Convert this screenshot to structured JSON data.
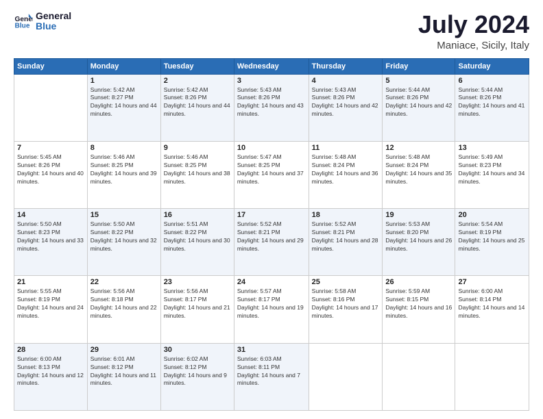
{
  "header": {
    "logo_line1": "General",
    "logo_line2": "Blue",
    "title": "July 2024",
    "subtitle": "Maniace, Sicily, Italy"
  },
  "days_of_week": [
    "Sunday",
    "Monday",
    "Tuesday",
    "Wednesday",
    "Thursday",
    "Friday",
    "Saturday"
  ],
  "weeks": [
    [
      {
        "day": null,
        "info": null
      },
      {
        "day": "1",
        "sunrise": "5:42 AM",
        "sunset": "8:27 PM",
        "daylight": "14 hours and 44 minutes."
      },
      {
        "day": "2",
        "sunrise": "5:42 AM",
        "sunset": "8:26 PM",
        "daylight": "14 hours and 44 minutes."
      },
      {
        "day": "3",
        "sunrise": "5:43 AM",
        "sunset": "8:26 PM",
        "daylight": "14 hours and 43 minutes."
      },
      {
        "day": "4",
        "sunrise": "5:43 AM",
        "sunset": "8:26 PM",
        "daylight": "14 hours and 42 minutes."
      },
      {
        "day": "5",
        "sunrise": "5:44 AM",
        "sunset": "8:26 PM",
        "daylight": "14 hours and 42 minutes."
      },
      {
        "day": "6",
        "sunrise": "5:44 AM",
        "sunset": "8:26 PM",
        "daylight": "14 hours and 41 minutes."
      }
    ],
    [
      {
        "day": "7",
        "sunrise": "5:45 AM",
        "sunset": "8:26 PM",
        "daylight": "14 hours and 40 minutes."
      },
      {
        "day": "8",
        "sunrise": "5:46 AM",
        "sunset": "8:25 PM",
        "daylight": "14 hours and 39 minutes."
      },
      {
        "day": "9",
        "sunrise": "5:46 AM",
        "sunset": "8:25 PM",
        "daylight": "14 hours and 38 minutes."
      },
      {
        "day": "10",
        "sunrise": "5:47 AM",
        "sunset": "8:25 PM",
        "daylight": "14 hours and 37 minutes."
      },
      {
        "day": "11",
        "sunrise": "5:48 AM",
        "sunset": "8:24 PM",
        "daylight": "14 hours and 36 minutes."
      },
      {
        "day": "12",
        "sunrise": "5:48 AM",
        "sunset": "8:24 PM",
        "daylight": "14 hours and 35 minutes."
      },
      {
        "day": "13",
        "sunrise": "5:49 AM",
        "sunset": "8:23 PM",
        "daylight": "14 hours and 34 minutes."
      }
    ],
    [
      {
        "day": "14",
        "sunrise": "5:50 AM",
        "sunset": "8:23 PM",
        "daylight": "14 hours and 33 minutes."
      },
      {
        "day": "15",
        "sunrise": "5:50 AM",
        "sunset": "8:22 PM",
        "daylight": "14 hours and 32 minutes."
      },
      {
        "day": "16",
        "sunrise": "5:51 AM",
        "sunset": "8:22 PM",
        "daylight": "14 hours and 30 minutes."
      },
      {
        "day": "17",
        "sunrise": "5:52 AM",
        "sunset": "8:21 PM",
        "daylight": "14 hours and 29 minutes."
      },
      {
        "day": "18",
        "sunrise": "5:52 AM",
        "sunset": "8:21 PM",
        "daylight": "14 hours and 28 minutes."
      },
      {
        "day": "19",
        "sunrise": "5:53 AM",
        "sunset": "8:20 PM",
        "daylight": "14 hours and 26 minutes."
      },
      {
        "day": "20",
        "sunrise": "5:54 AM",
        "sunset": "8:19 PM",
        "daylight": "14 hours and 25 minutes."
      }
    ],
    [
      {
        "day": "21",
        "sunrise": "5:55 AM",
        "sunset": "8:19 PM",
        "daylight": "14 hours and 24 minutes."
      },
      {
        "day": "22",
        "sunrise": "5:56 AM",
        "sunset": "8:18 PM",
        "daylight": "14 hours and 22 minutes."
      },
      {
        "day": "23",
        "sunrise": "5:56 AM",
        "sunset": "8:17 PM",
        "daylight": "14 hours and 21 minutes."
      },
      {
        "day": "24",
        "sunrise": "5:57 AM",
        "sunset": "8:17 PM",
        "daylight": "14 hours and 19 minutes."
      },
      {
        "day": "25",
        "sunrise": "5:58 AM",
        "sunset": "8:16 PM",
        "daylight": "14 hours and 17 minutes."
      },
      {
        "day": "26",
        "sunrise": "5:59 AM",
        "sunset": "8:15 PM",
        "daylight": "14 hours and 16 minutes."
      },
      {
        "day": "27",
        "sunrise": "6:00 AM",
        "sunset": "8:14 PM",
        "daylight": "14 hours and 14 minutes."
      }
    ],
    [
      {
        "day": "28",
        "sunrise": "6:00 AM",
        "sunset": "8:13 PM",
        "daylight": "14 hours and 12 minutes."
      },
      {
        "day": "29",
        "sunrise": "6:01 AM",
        "sunset": "8:12 PM",
        "daylight": "14 hours and 11 minutes."
      },
      {
        "day": "30",
        "sunrise": "6:02 AM",
        "sunset": "8:12 PM",
        "daylight": "14 hours and 9 minutes."
      },
      {
        "day": "31",
        "sunrise": "6:03 AM",
        "sunset": "8:11 PM",
        "daylight": "14 hours and 7 minutes."
      },
      {
        "day": null,
        "info": null
      },
      {
        "day": null,
        "info": null
      },
      {
        "day": null,
        "info": null
      }
    ]
  ],
  "labels": {
    "sunrise_label": "Sunrise:",
    "sunset_label": "Sunset:",
    "daylight_label": "Daylight: "
  }
}
